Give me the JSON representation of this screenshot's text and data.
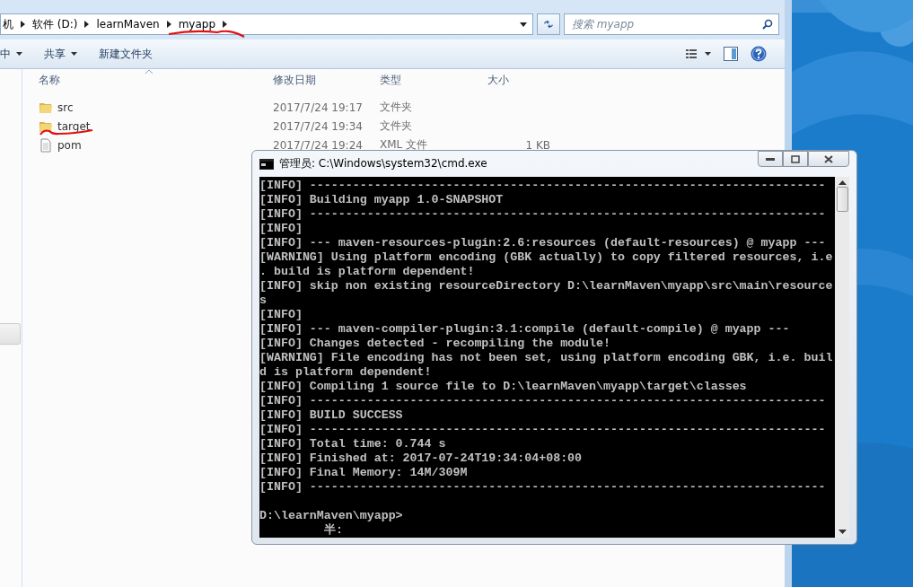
{
  "explorer": {
    "breadcrumb": [
      "机",
      "软件 (D:)",
      "learnMaven",
      "myapp"
    ],
    "search": {
      "placeholder": "搜索 myapp"
    },
    "toolbar": [
      {
        "label": "中",
        "menu": true
      },
      {
        "label": "共享",
        "menu": true
      },
      {
        "label": "新建文件夹",
        "menu": false
      }
    ],
    "columns": [
      "名称",
      "修改日期",
      "类型",
      "大小"
    ],
    "files": [
      {
        "kind": "folder",
        "name": "src",
        "modified": "2017/7/24 19:17",
        "type": "文件夹"
      },
      {
        "kind": "folder",
        "name": "target",
        "modified": "2017/7/24 19:34",
        "type": "文件夹"
      },
      {
        "kind": "file",
        "name": "pom",
        "modified": "2017/7/24 19:24",
        "type": "XML 文件",
        "size": "1 KB"
      }
    ]
  },
  "cmd": {
    "title": "管理员: C:\\Windows\\system32\\cmd.exe",
    "lines": [
      {
        "kind": "text",
        "text": "[INFO] ------------------------------------------------------------------------"
      },
      {
        "kind": "text",
        "text": "[INFO] Building myapp 1.0-SNAPSHOT"
      },
      {
        "kind": "text",
        "text": "[INFO] ------------------------------------------------------------------------"
      },
      {
        "kind": "text",
        "text": "[INFO]"
      },
      {
        "kind": "text",
        "text": "[INFO] --- maven-resources-plugin:2.6:resources (default-resources) @ myapp ---"
      },
      {
        "kind": "text",
        "text": "[WARNING] Using platform encoding (GBK actually) to copy filtered resources, i.e"
      },
      {
        "kind": "text",
        "text": ". build is platform dependent!"
      },
      {
        "kind": "text",
        "text": "[INFO] skip non existing resourceDirectory D:\\learnMaven\\myapp\\src\\main\\resource"
      },
      {
        "kind": "text",
        "text": "s"
      },
      {
        "kind": "text",
        "text": "[INFO]"
      },
      {
        "kind": "text",
        "text": "[INFO] --- maven-compiler-plugin:3.1:compile (default-compile) @ myapp ---"
      },
      {
        "kind": "text",
        "text": "[INFO] Changes detected - recompiling the module!"
      },
      {
        "kind": "text",
        "text": "[WARNING] File encoding has not been set, using platform encoding GBK, i.e. buil"
      },
      {
        "kind": "text",
        "text": "d is platform dependent!"
      },
      {
        "kind": "text",
        "text": "[INFO] Compiling 1 source file to D:\\learnMaven\\myapp\\target\\classes"
      },
      {
        "kind": "text",
        "text": "[INFO] ------------------------------------------------------------------------"
      },
      {
        "kind": "text",
        "text": "[INFO] BUILD SUCCESS"
      },
      {
        "kind": "text",
        "text": "[INFO] ------------------------------------------------------------------------"
      },
      {
        "kind": "text",
        "text": "[INFO] Total time: 0.744 s"
      },
      {
        "kind": "text",
        "text": "[INFO] Finished at: 2017-07-24T19:34:04+08:00"
      },
      {
        "kind": "text",
        "text": "[INFO] Final Memory: 14M/309M"
      },
      {
        "kind": "text",
        "text": "[INFO] ------------------------------------------------------------------------"
      },
      {
        "kind": "blank"
      },
      {
        "kind": "text",
        "text": "D:\\learnMaven\\myapp>"
      },
      {
        "kind": "ime",
        "text": "半:"
      }
    ]
  }
}
